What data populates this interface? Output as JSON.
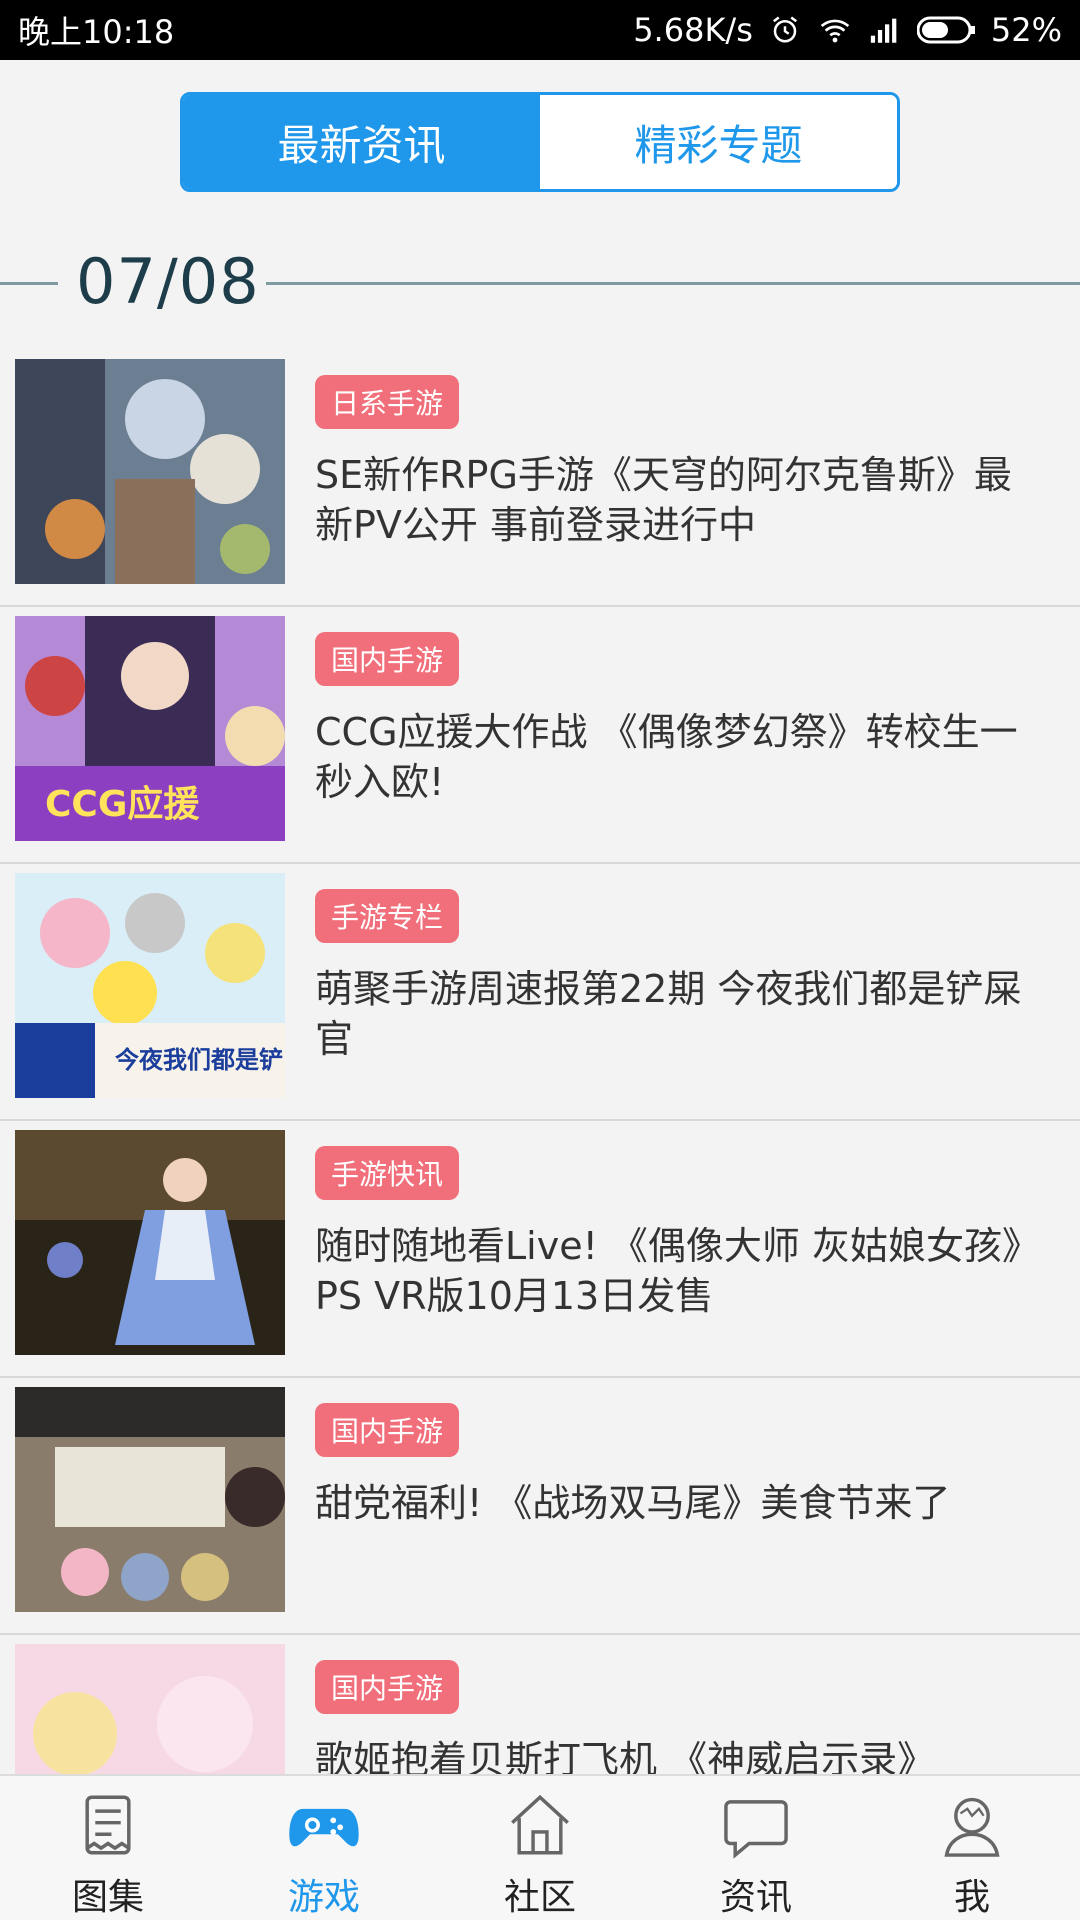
{
  "status_bar": {
    "time": "晚上10:18",
    "speed": "5.68K/s",
    "battery": "52%",
    "icons": [
      "alarm-icon",
      "wifi-icon",
      "signal-icon",
      "battery-icon"
    ]
  },
  "tabs": [
    {
      "label": "最新资讯",
      "active": true
    },
    {
      "label": "精彩专题",
      "active": false
    }
  ],
  "date": "07/08",
  "news": [
    {
      "tag": "日系手游",
      "title": "SE新作RPG手游《天穹的阿尔克鲁斯》最新PV公开 事前登录进行中"
    },
    {
      "tag": "国内手游",
      "title": "CCG应援大作战 《偶像梦幻祭》转校生一秒入欧!"
    },
    {
      "tag": "手游专栏",
      "title": "萌聚手游周速报第22期 今夜我们都是铲屎官"
    },
    {
      "tag": "手游快讯",
      "title": "随时随地看Live! 《偶像大师 灰姑娘女孩》PS VR版10月13日发售"
    },
    {
      "tag": "国内手游",
      "title": "甜党福利! 《战场双马尾》美食节来了"
    },
    {
      "tag": "国内手游",
      "title": "歌姬抱着贝斯打飞机 《神威启示录》"
    }
  ],
  "bottom_nav": [
    {
      "label": "图集",
      "icon": "gallery-icon",
      "active": false
    },
    {
      "label": "游戏",
      "icon": "gamepad-icon",
      "active": true
    },
    {
      "label": "社区",
      "icon": "home-icon",
      "active": false
    },
    {
      "label": "资讯",
      "icon": "chat-icon",
      "active": false
    },
    {
      "label": "我",
      "icon": "profile-icon",
      "active": false
    }
  ],
  "colors": {
    "accent": "#1f97ea",
    "tag": "#f16f7a",
    "date_text": "#1e3d4a"
  }
}
